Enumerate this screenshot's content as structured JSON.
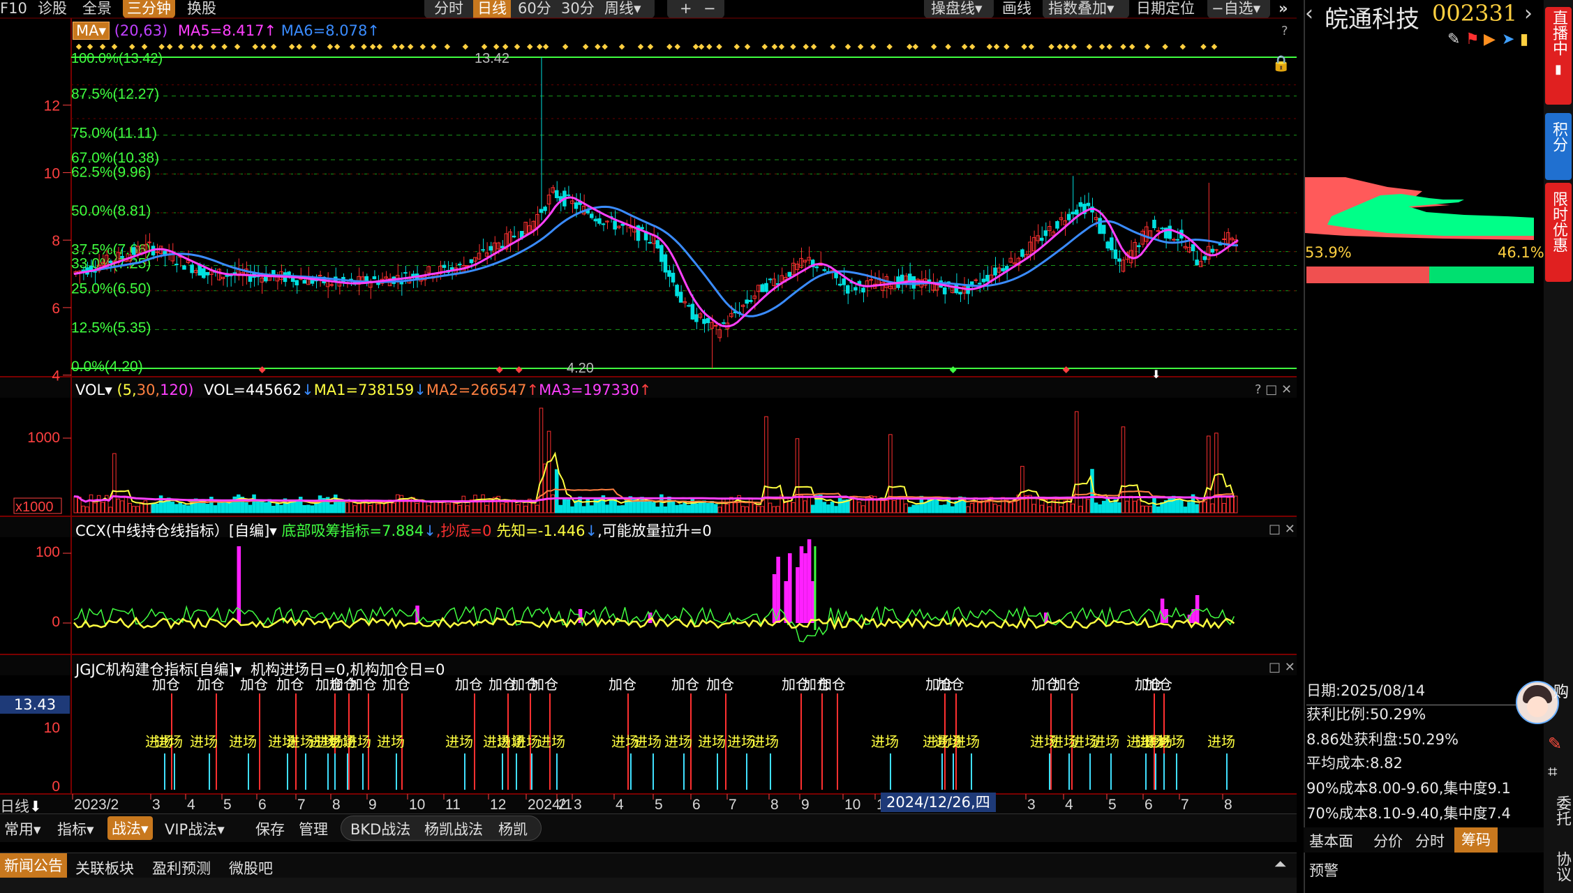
{
  "toolbar": {
    "left_items": [
      "F10",
      "诊股",
      "全景",
      "三分钟",
      "换股"
    ],
    "active_left": "三分钟",
    "period_tabs": [
      "分时",
      "日线",
      "60分",
      "30分",
      "周线▾"
    ],
    "active_period": "日线",
    "zoom_in": "+",
    "zoom_out": "−",
    "right_items": [
      "操盘线▾",
      "画线",
      "指数叠加▾",
      "日期定位",
      "−自选▾"
    ],
    "close_icon": "double-arrow-icon"
  },
  "main_chart": {
    "selector": "MA▾",
    "params": "(20,63)",
    "ma5": "MA5=8.417↑",
    "ma6": "MA6=8.078↑",
    "top_label": "100.0%(13.42)",
    "high_label": "13.42",
    "low_label": "4.20",
    "help": "?",
    "lock_icon": "lock-icon",
    "y_ticks": [
      "12",
      "10",
      "8",
      "6",
      "4"
    ],
    "fib_levels": [
      "87.5%(12.27)",
      "75.0%(11.11)",
      "67.0%(10.38)",
      "62.5%(9.96)",
      "50.0%(8.81)",
      "37.5%(7.66)",
      "33.0%(7.25)",
      "25.0%(6.50)",
      "12.5%(5.35)",
      "0.0%(4.20)"
    ]
  },
  "vol_panel": {
    "selector": "VOL▾",
    "params_a": "(5,",
    "params_b": "30,",
    "params_c": "120)",
    "vol": "VOL=445662",
    "ma1": "MA1=738159",
    "ma2": "MA2=266547",
    "ma3": "MA3=197330",
    "y_tick": "1000",
    "unit": "x1000",
    "controls": "? □ ✕"
  },
  "ccx_panel": {
    "title": "CCX(中线持仓线指标）[自编]▾",
    "a": "底部吸筹指标=7.884",
    "b": "抄底=0",
    "c": "先知=-1.446",
    "d": "可能放量拉升=0",
    "y_ticks": [
      "100",
      "0"
    ],
    "controls": "□ ✕"
  },
  "jgjc_panel": {
    "title": "JGJC机构建仓指标[自编]▾",
    "a": "机构进场日=0,",
    "b": "机构加仓日=0",
    "y_ticks": [
      "10",
      "0"
    ],
    "price_tag": "13.43",
    "add_label": "加仓",
    "enter_label": "进场",
    "controls": "□ ✕"
  },
  "x_axis": {
    "left_label": "日线",
    "ticks": [
      "2023/2",
      "3",
      "4",
      "5",
      "6",
      "7",
      "8",
      "9",
      "10",
      "11",
      "12",
      "2024/1",
      "2",
      "3",
      "4",
      "5",
      "6",
      "7",
      "8",
      "9",
      "10",
      "1",
      "2",
      "3",
      "4",
      "5",
      "6",
      "7",
      "8"
    ],
    "cursor_date": "2024/12/26,四"
  },
  "bottom_bar1": {
    "items": [
      "常用▾",
      "指标▾",
      "战法▾",
      "VIP战法▾",
      "保存",
      "管理",
      "BKD战法",
      "杨凯战法",
      "杨凯"
    ],
    "active": "战法▾"
  },
  "bottom_bar2": {
    "items": [
      "新闻公告",
      "关联板块",
      "盈利预测",
      "微股吧"
    ],
    "active": "新闻公告"
  },
  "stock": {
    "name": "皖通科技",
    "code": "002331",
    "profit_pct": "53.9%",
    "loss_pct": "46.1%",
    "date": "日期:2025/08/14",
    "profit_ratio": "获利比例:50.29%",
    "profit_at": "8.86处获利盘:50.29%",
    "avg_cost": "平均成本:8.82",
    "cost90": "90%成本8.00-9.60,集中度9.1",
    "cost70": "70%成本8.10-9.40,集中度7.4",
    "tabs": [
      "基本面",
      "分价",
      "分时",
      "筹码"
    ],
    "active_tab": "筹码",
    "alert": "预警"
  },
  "rail": {
    "live": "直播中",
    "points": "积分",
    "promo": "限时优惠",
    "buy": "购",
    "entrust": "委托",
    "protocol": "协议"
  },
  "colors": {
    "accent": "#c8781e",
    "up": "#ff3030",
    "down": "#00ffa0",
    "ma_pink": "#ff40ff",
    "ma_blue": "#3a8cff",
    "yellow": "#ffff40",
    "fib": "#40ff40"
  }
}
